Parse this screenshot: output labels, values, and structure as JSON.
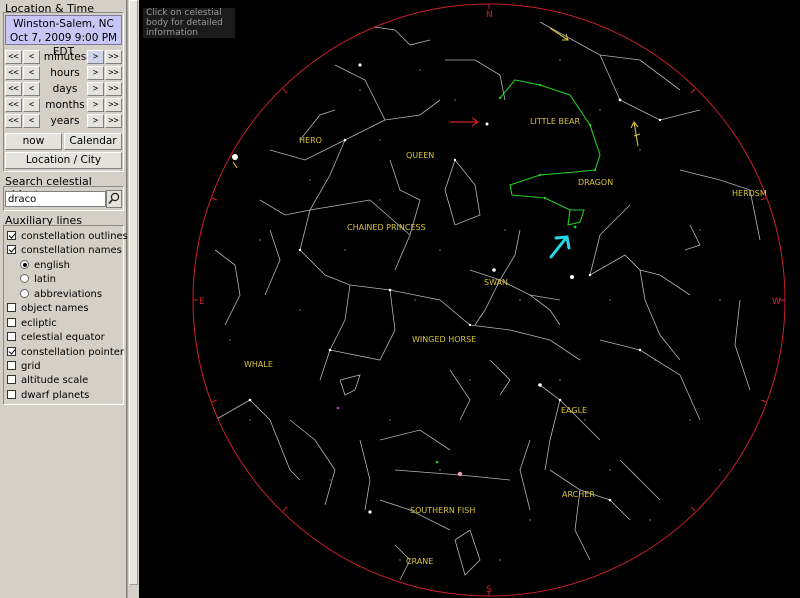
{
  "location_time": {
    "title": "Location & Time",
    "place": "Winston-Salem, NC",
    "datetime": "Oct 7, 2009 9:00 PM EDT",
    "steps": [
      {
        "label": "minutes"
      },
      {
        "label": "hours"
      },
      {
        "label": "days"
      },
      {
        "label": "months"
      },
      {
        "label": "years"
      }
    ],
    "btn_back_fast": "<<",
    "btn_back": "<",
    "btn_fwd": ">",
    "btn_fwd_fast": ">>",
    "now_label": "now",
    "calendar_label": "Calendar",
    "location_city_label": "Location / City"
  },
  "search": {
    "title": "Search celestial object",
    "value": "draco"
  },
  "aux": {
    "title": "Auxiliary lines",
    "options": [
      {
        "label": "constellation outlines",
        "checked": true
      },
      {
        "label": "constellation names",
        "checked": true
      },
      {
        "label": "english",
        "radio": true,
        "selected": true
      },
      {
        "label": "latin",
        "radio": true,
        "selected": false
      },
      {
        "label": "abbreviations",
        "radio": true,
        "selected": false
      },
      {
        "label": "object names",
        "checked": false
      },
      {
        "label": "ecliptic",
        "checked": false
      },
      {
        "label": "celestial equator",
        "checked": false
      },
      {
        "label": "constellation pointer",
        "checked": true
      },
      {
        "label": "grid",
        "checked": false
      },
      {
        "label": "altitude scale",
        "checked": false
      },
      {
        "label": "dwarf planets",
        "checked": false
      }
    ]
  },
  "sky": {
    "hint": "Click on celestial body for detailed information",
    "cardinals": {
      "north": "N",
      "south": "S",
      "east": "E",
      "west": "W"
    },
    "constellations": {
      "little_bear": "LITTLE BEAR",
      "hero": "HERO",
      "queen": "QUEEN",
      "dragon": "DRAGON",
      "herdsman": "HERDSM",
      "chained_princess": "CHAINED PRINCESS",
      "swan": "SWAN",
      "winged_horse": "WINGED HORSE",
      "whale": "WHALE",
      "eagle": "EAGLE",
      "archer": "ARCHER",
      "southern_fish": "SOUTHERN FISH",
      "crane": "CRANE"
    },
    "colors": {
      "horizon": "#c8202a",
      "outline": "#b4b4b4",
      "highlight": "#22cc22",
      "pointer": "#22d8e8",
      "label": "#d8c23a",
      "arrow_red": "#d02020",
      "arrow_yellow": "#d8c23a"
    }
  }
}
